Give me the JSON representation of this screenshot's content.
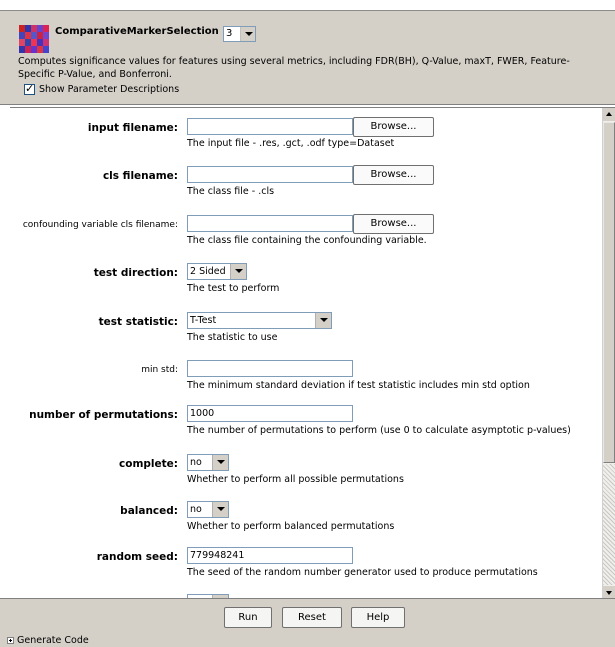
{
  "header": {
    "module_name": "ComparativeMarkerSelection",
    "version": "3",
    "description": "Computes significance values for features using several metrics, including FDR(BH), Q-Value, maxT, FWER, Feature-Specific P-Value, and Bonferroni.",
    "show_descriptions_label": "Show Parameter Descriptions",
    "show_descriptions_checked": true
  },
  "params": [
    {
      "label": "input filename:",
      "value": "",
      "button": "Browse...",
      "hint": "The input file - .res, .gct, .odf type=Dataset"
    },
    {
      "label": "cls filename:",
      "value": "",
      "button": "Browse...",
      "hint": "The class file - .cls"
    },
    {
      "label": "confounding variable cls filename:",
      "value": "",
      "button": "Browse...",
      "hint": "The class file containing the confounding variable."
    },
    {
      "label": "test direction:",
      "value": "2 Sided",
      "hint": "The test to perform"
    },
    {
      "label": "test statistic:",
      "value": "T-Test",
      "hint": "The statistic to use"
    },
    {
      "label": "min std:",
      "value": "",
      "hint": "The minimum standard deviation if test statistic includes min std option"
    },
    {
      "label": "number of permutations:",
      "value": "1000",
      "hint": "The number of permutations to perform (use 0 to calculate asymptotic p-values)"
    },
    {
      "label": "complete:",
      "value": "no",
      "hint": "Whether to perform all possible permutations"
    },
    {
      "label": "balanced:",
      "value": "no",
      "hint": "Whether to perform balanced permutations"
    },
    {
      "label": "random seed:",
      "value": "779948241",
      "hint": "The seed of the random number generator used to produce permutations"
    }
  ],
  "footer": {
    "run": "Run",
    "reset": "Reset",
    "help": "Help",
    "generate_code": "Generate Code"
  },
  "colors": {
    "panel": "#d4d0c8",
    "field_border": "#7f9db9"
  }
}
